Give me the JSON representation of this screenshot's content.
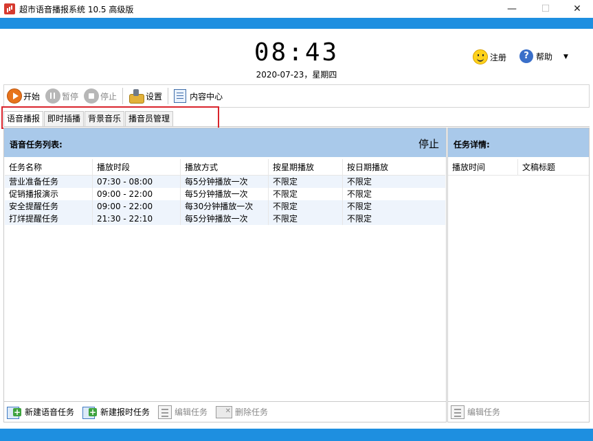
{
  "window": {
    "title": "超市语音播报系统 10.5 高级版",
    "minimize": "—",
    "maximize": "☐",
    "close": "✕"
  },
  "header": {
    "time": "08:43",
    "date": "2020-07-23，星期四",
    "register_label": "注册",
    "help_label": "帮助",
    "dropdown_icon": "▼"
  },
  "toolbar": {
    "start": "开始",
    "pause": "暂停",
    "stop": "停止",
    "settings": "设置",
    "content_center": "内容中心"
  },
  "tabs": [
    "语音播报",
    "即时插播",
    "背景音乐",
    "播音员管理"
  ],
  "task_list": {
    "title": "语音任务列表:",
    "status": "停止",
    "columns": [
      "任务名称",
      "播放时段",
      "播放方式",
      "按星期播放",
      "按日期播放"
    ],
    "rows": [
      [
        "营业准备任务",
        "07:30 - 08:00",
        "每5分钟播放一次",
        "不限定",
        "不限定"
      ],
      [
        "促销播报演示",
        "09:00 - 22:00",
        "每5分钟播放一次",
        "不限定",
        "不限定"
      ],
      [
        "安全提醒任务",
        "09:00 - 22:00",
        "每30分钟播放一次",
        "不限定",
        "不限定"
      ],
      [
        "打烊提醒任务",
        "21:30 - 22:10",
        "每5分钟播放一次",
        "不限定",
        "不限定"
      ]
    ],
    "footer": {
      "new_voice_task": "新建语音任务",
      "new_time_task": "新建报时任务",
      "edit_task": "编辑任务",
      "delete_task": "删除任务"
    }
  },
  "task_detail": {
    "title": "任务详情:",
    "columns": [
      "播放时间",
      "文稿标题"
    ],
    "footer": {
      "edit_task": "编辑任务"
    }
  },
  "colors": {
    "accent_blue": "#1e8fe0",
    "panel_header": "#a9c9ea",
    "highlight_red": "#d9232b"
  }
}
